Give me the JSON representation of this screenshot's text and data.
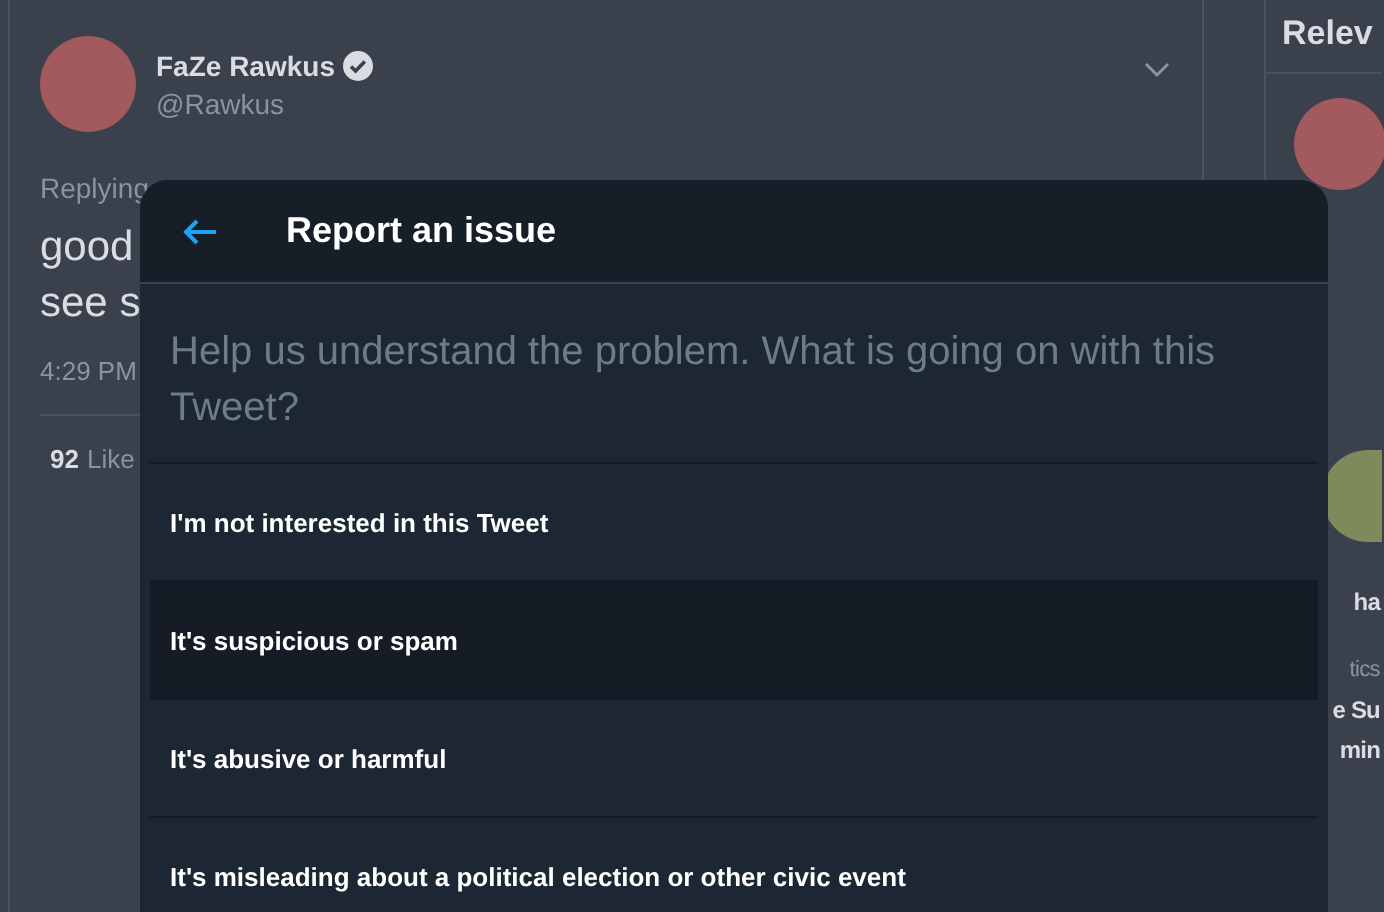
{
  "tweet": {
    "author": "FaZe Rawkus",
    "handle": "@Rawkus",
    "replying": "Replying",
    "text_lines": [
      "good",
      "see s"
    ],
    "time": "4:29 PM",
    "likes_count": "92",
    "likes_label": "Like"
  },
  "sidebar": {
    "heading": "Relev",
    "fragments": [
      {
        "text": "ha",
        "kind": "title"
      },
      {
        "text": "tics",
        "kind": "meta"
      },
      {
        "text": "e Su",
        "kind": "title"
      },
      {
        "text": "min",
        "kind": "title"
      }
    ]
  },
  "dialog": {
    "title": "Report an issue",
    "prompt": "Help us understand the problem. What is going on with this Tweet?",
    "options": [
      {
        "label": "I'm not interested in this Tweet",
        "selected": false
      },
      {
        "label": "It's suspicious or spam",
        "selected": true
      },
      {
        "label": "It's abusive or harmful",
        "selected": false
      },
      {
        "label": "It's misleading about a political election or other civic event",
        "selected": false
      }
    ]
  }
}
